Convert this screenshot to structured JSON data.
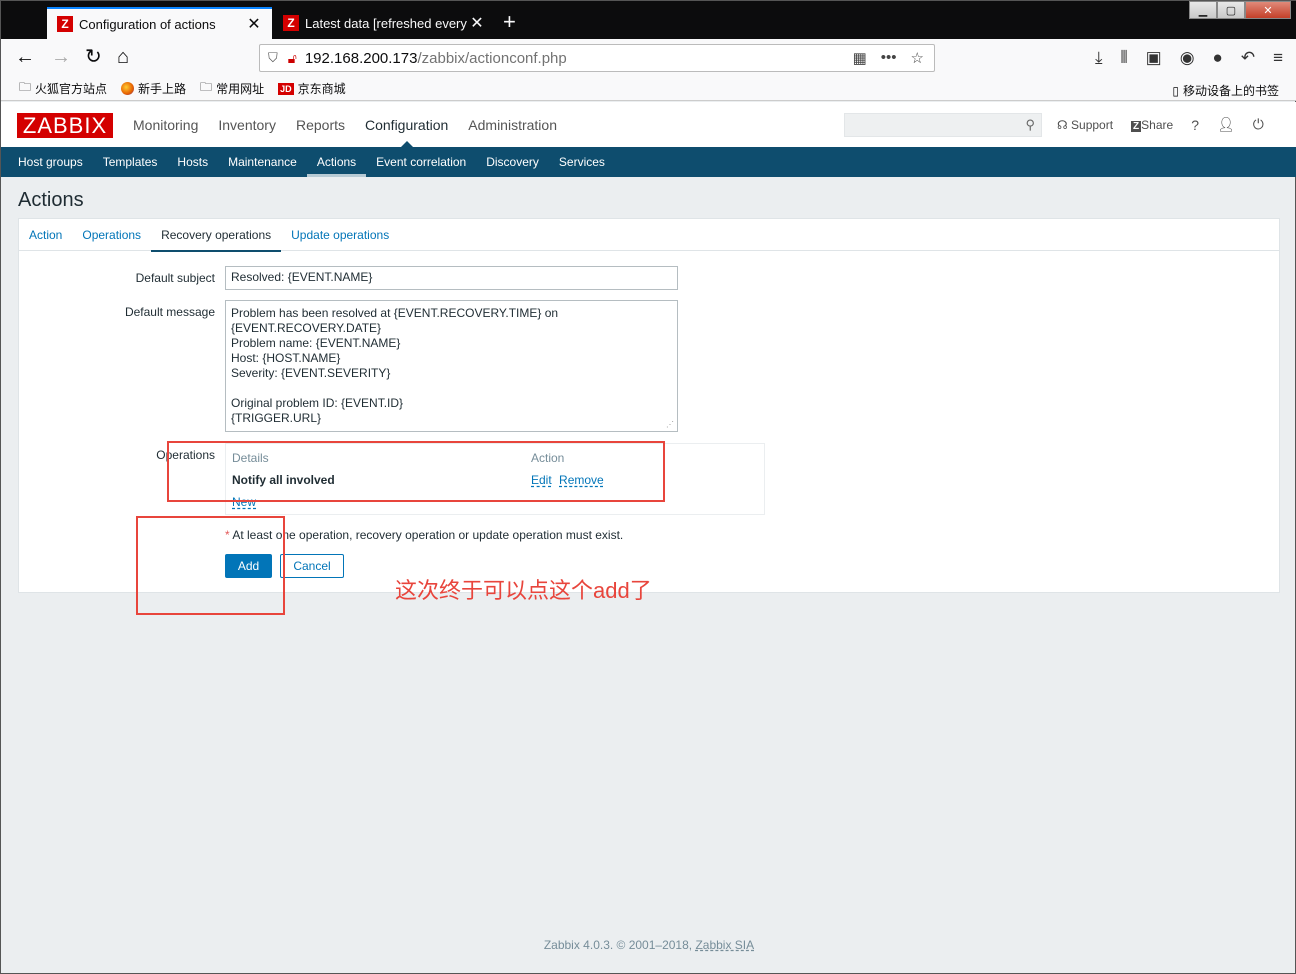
{
  "browser": {
    "tabs": [
      {
        "title": "Configuration of actions"
      },
      {
        "title": "Latest data [refreshed every"
      }
    ],
    "url_host": "192.168.200.173",
    "url_path": "/zabbix/actionconf.php",
    "bookmarks": [
      "火狐官方站点",
      "新手上路",
      "常用网址",
      "京东商城"
    ],
    "mobile_bookmarks": "移动设备上的书签",
    "jd_badge": "JD"
  },
  "zabbix": {
    "logo": "ZABBIX",
    "top_menu": [
      "Monitoring",
      "Inventory",
      "Reports",
      "Configuration",
      "Administration"
    ],
    "top_menu_selected": "Configuration",
    "support": "Support",
    "share": "Share",
    "help": "?",
    "sub_menu": [
      "Host groups",
      "Templates",
      "Hosts",
      "Maintenance",
      "Actions",
      "Event correlation",
      "Discovery",
      "Services"
    ],
    "sub_menu_selected": "Actions"
  },
  "page": {
    "title": "Actions",
    "form_tabs": [
      "Action",
      "Operations",
      "Recovery operations",
      "Update operations"
    ],
    "form_tab_selected": "Recovery operations",
    "default_subject_label": "Default subject",
    "default_subject_value": "Resolved: {EVENT.NAME}",
    "default_message_label": "Default message",
    "default_message_value": "Problem has been resolved at {EVENT.RECOVERY.TIME} on\n{EVENT.RECOVERY.DATE}\nProblem name: {EVENT.NAME}\nHost: {HOST.NAME}\nSeverity: {EVENT.SEVERITY}\n\nOriginal problem ID: {EVENT.ID}\n{TRIGGER.URL}",
    "operations_label": "Operations",
    "operations_headers": {
      "details": "Details",
      "action": "Action"
    },
    "operations_row": {
      "details": "Notify all involved",
      "edit": "Edit",
      "remove": "Remove"
    },
    "new_link": "New",
    "required_star": "*",
    "required_note": "At least one operation, recovery operation or update operation must exist.",
    "add_button": "Add",
    "cancel_button": "Cancel"
  },
  "annotation": {
    "text": "这次终于可以点这个add了",
    "color": "#e8453c"
  },
  "footer": {
    "text": "Zabbix 4.0.3. © 2001–2018, ",
    "link": "Zabbix SIA"
  }
}
